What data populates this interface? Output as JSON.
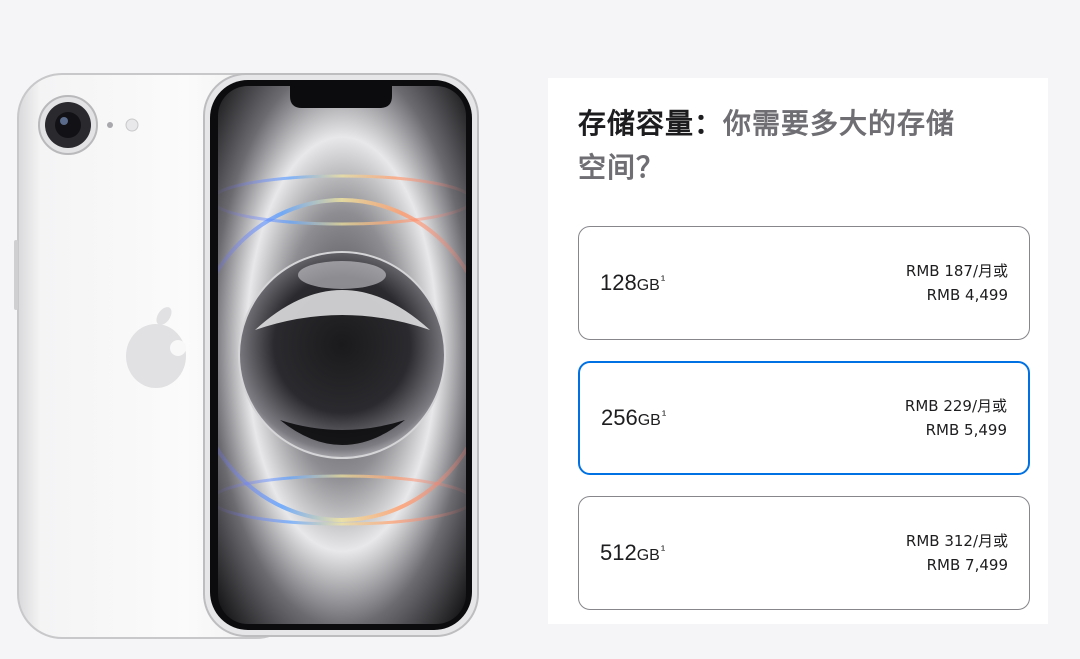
{
  "heading": {
    "strong": "存储容量：",
    "soft": "你需要多大的存储空间？"
  },
  "colors": {
    "background": "#f5f5f7",
    "panel": "#ffffff",
    "text": "#1d1d1f",
    "text_secondary": "#6e6e73",
    "border": "#86868b",
    "selected_border": "#0071e3"
  },
  "product_image": {
    "icon": "iphone-product-image"
  },
  "options": [
    {
      "size": "128",
      "unit": "GB",
      "footnote": "¹",
      "monthly": "RMB 187/月或",
      "price": "RMB 4,499",
      "selected": false
    },
    {
      "size": "256",
      "unit": "GB",
      "footnote": "¹",
      "monthly": "RMB 229/月或",
      "price": "RMB 5,499",
      "selected": true
    },
    {
      "size": "512",
      "unit": "GB",
      "footnote": "¹",
      "monthly": "RMB 312/月或",
      "price": "RMB 7,499",
      "selected": false
    }
  ]
}
